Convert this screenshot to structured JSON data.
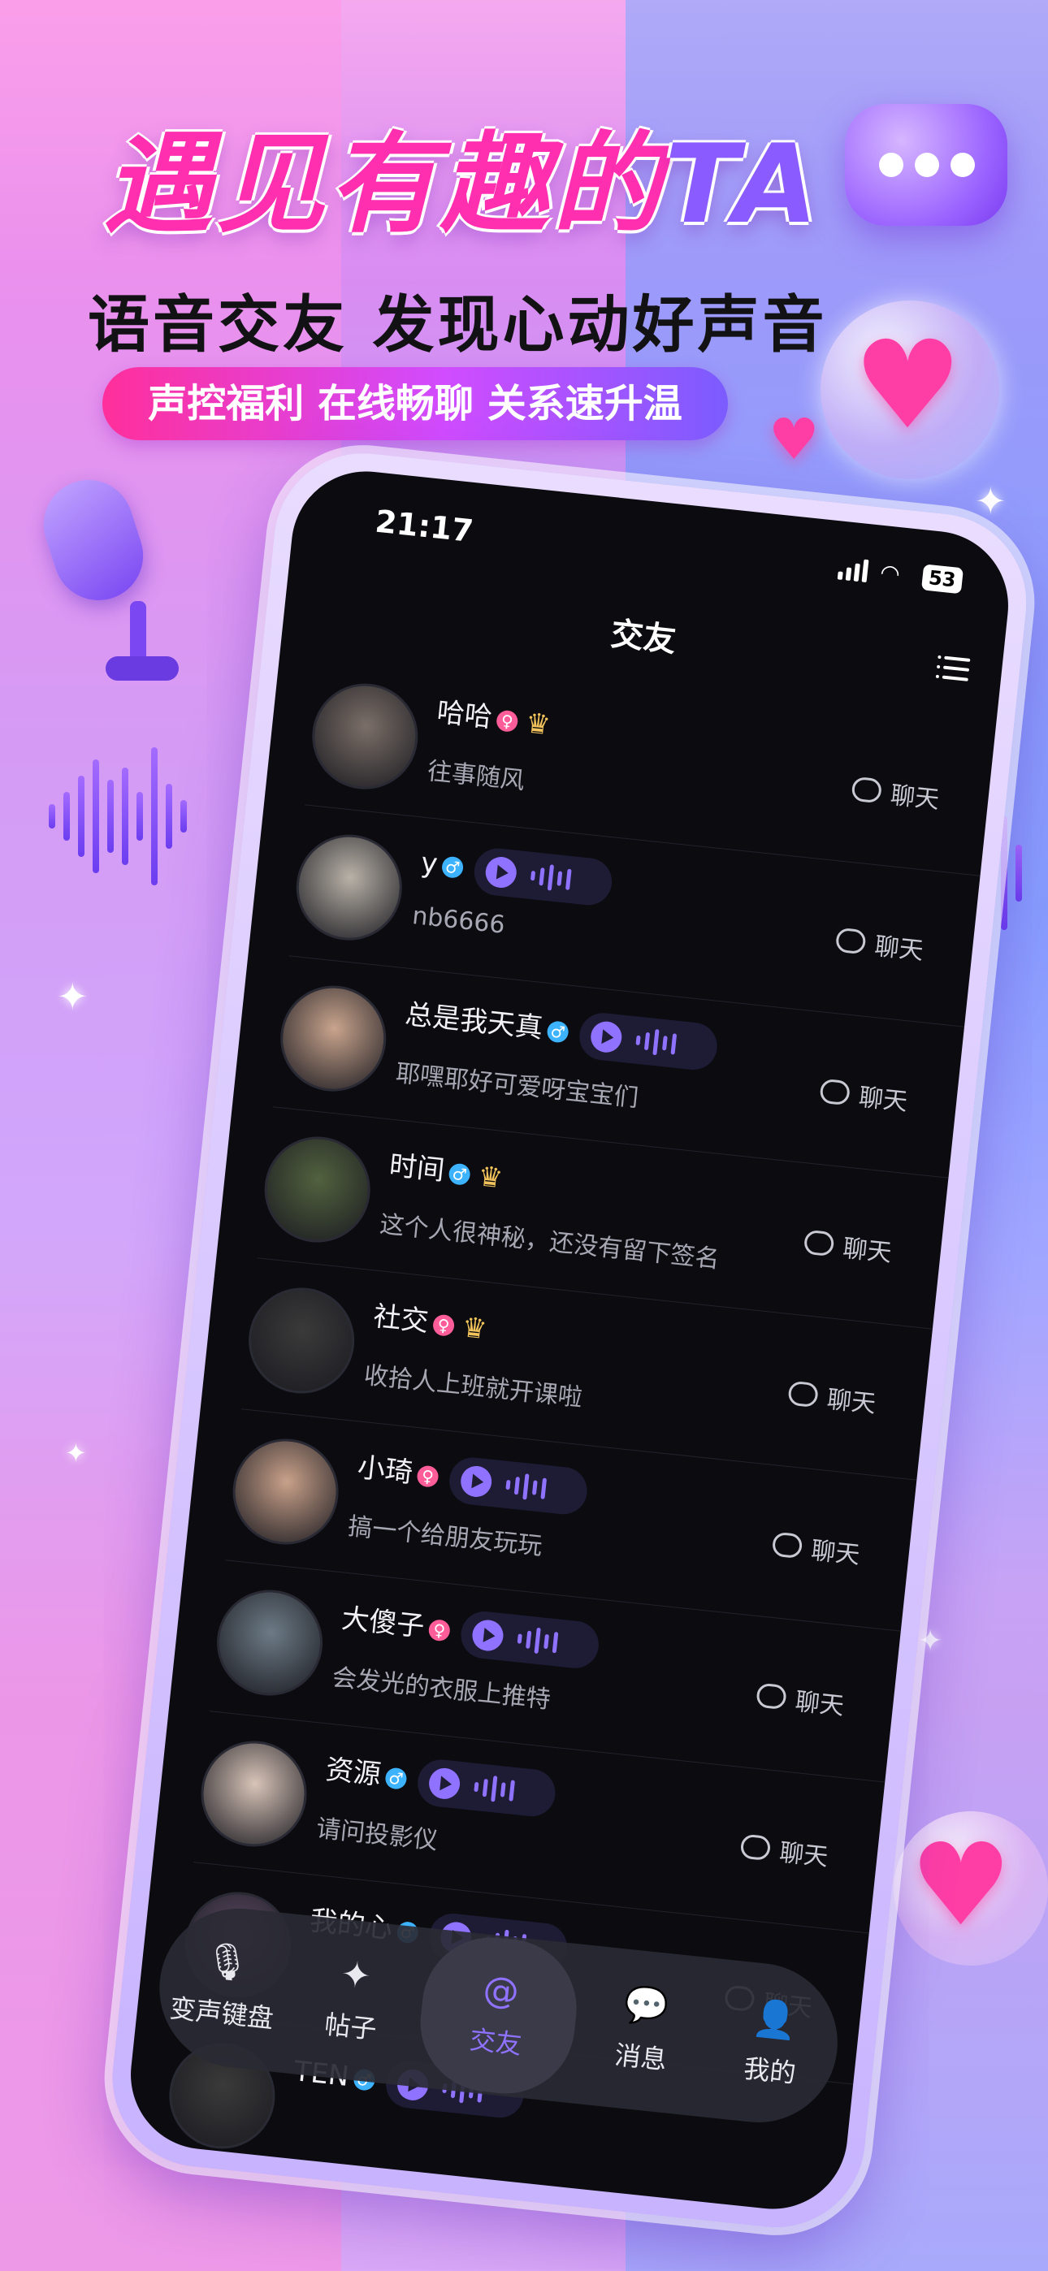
{
  "promo": {
    "headline_main": "遇见有趣的",
    "headline_accent": "TA",
    "subheadline": "语音交友 发现心动好声音",
    "pill": "声控福利 在线畅聊 关系速升温"
  },
  "status_bar": {
    "time": "21:17",
    "battery": "53"
  },
  "header": {
    "title": "交友",
    "menu_icon": "menu-list-icon"
  },
  "colors": {
    "accent": "#8f72ff",
    "female": "#ff5d9a",
    "male": "#3db3ff",
    "crown": "#f2c35b"
  },
  "users": [
    {
      "name": "哈哈",
      "gender": "female",
      "badge": "crown",
      "voice": false,
      "sign": "往事随风",
      "chat": "聊天"
    },
    {
      "name": "y",
      "gender": "male",
      "badge": "",
      "voice": true,
      "sign": "nb6666",
      "chat": "聊天"
    },
    {
      "name": "总是我天真",
      "gender": "male",
      "badge": "",
      "voice": true,
      "sign": "耶嘿耶好可爱呀宝宝们",
      "chat": "聊天"
    },
    {
      "name": "时间",
      "gender": "male",
      "badge": "crown",
      "voice": false,
      "sign": "这个人很神秘，还没有留下签名",
      "chat": "聊天"
    },
    {
      "name": "社交",
      "gender": "female",
      "badge": "crown",
      "voice": false,
      "sign": "收拾人上班就开课啦",
      "chat": "聊天"
    },
    {
      "name": "小琦",
      "gender": "female",
      "badge": "",
      "voice": true,
      "sign": "搞一个给朋友玩玩",
      "chat": "聊天"
    },
    {
      "name": "大傻子",
      "gender": "female",
      "badge": "",
      "voice": true,
      "sign": "会发光的衣服上推特",
      "chat": "聊天"
    },
    {
      "name": "资源",
      "gender": "male",
      "badge": "",
      "voice": true,
      "sign": "请问投影仪",
      "chat": "聊天"
    },
    {
      "name": "我的心",
      "gender": "male",
      "badge": "",
      "voice": true,
      "sign": "",
      "chat": "聊天"
    },
    {
      "name": "TEN",
      "gender": "male",
      "badge": "",
      "voice": true,
      "sign": "",
      "chat": ""
    }
  ],
  "tabs": [
    {
      "label": "变声键盘",
      "icon": "microphone-icon",
      "active": false
    },
    {
      "label": "帖子",
      "icon": "sparkle-icon",
      "active": false
    },
    {
      "label": "交友",
      "icon": "at-icon",
      "active": true
    },
    {
      "label": "消息",
      "icon": "chat-bubble-icon",
      "active": false
    },
    {
      "label": "我的",
      "icon": "person-icon",
      "active": false
    }
  ]
}
